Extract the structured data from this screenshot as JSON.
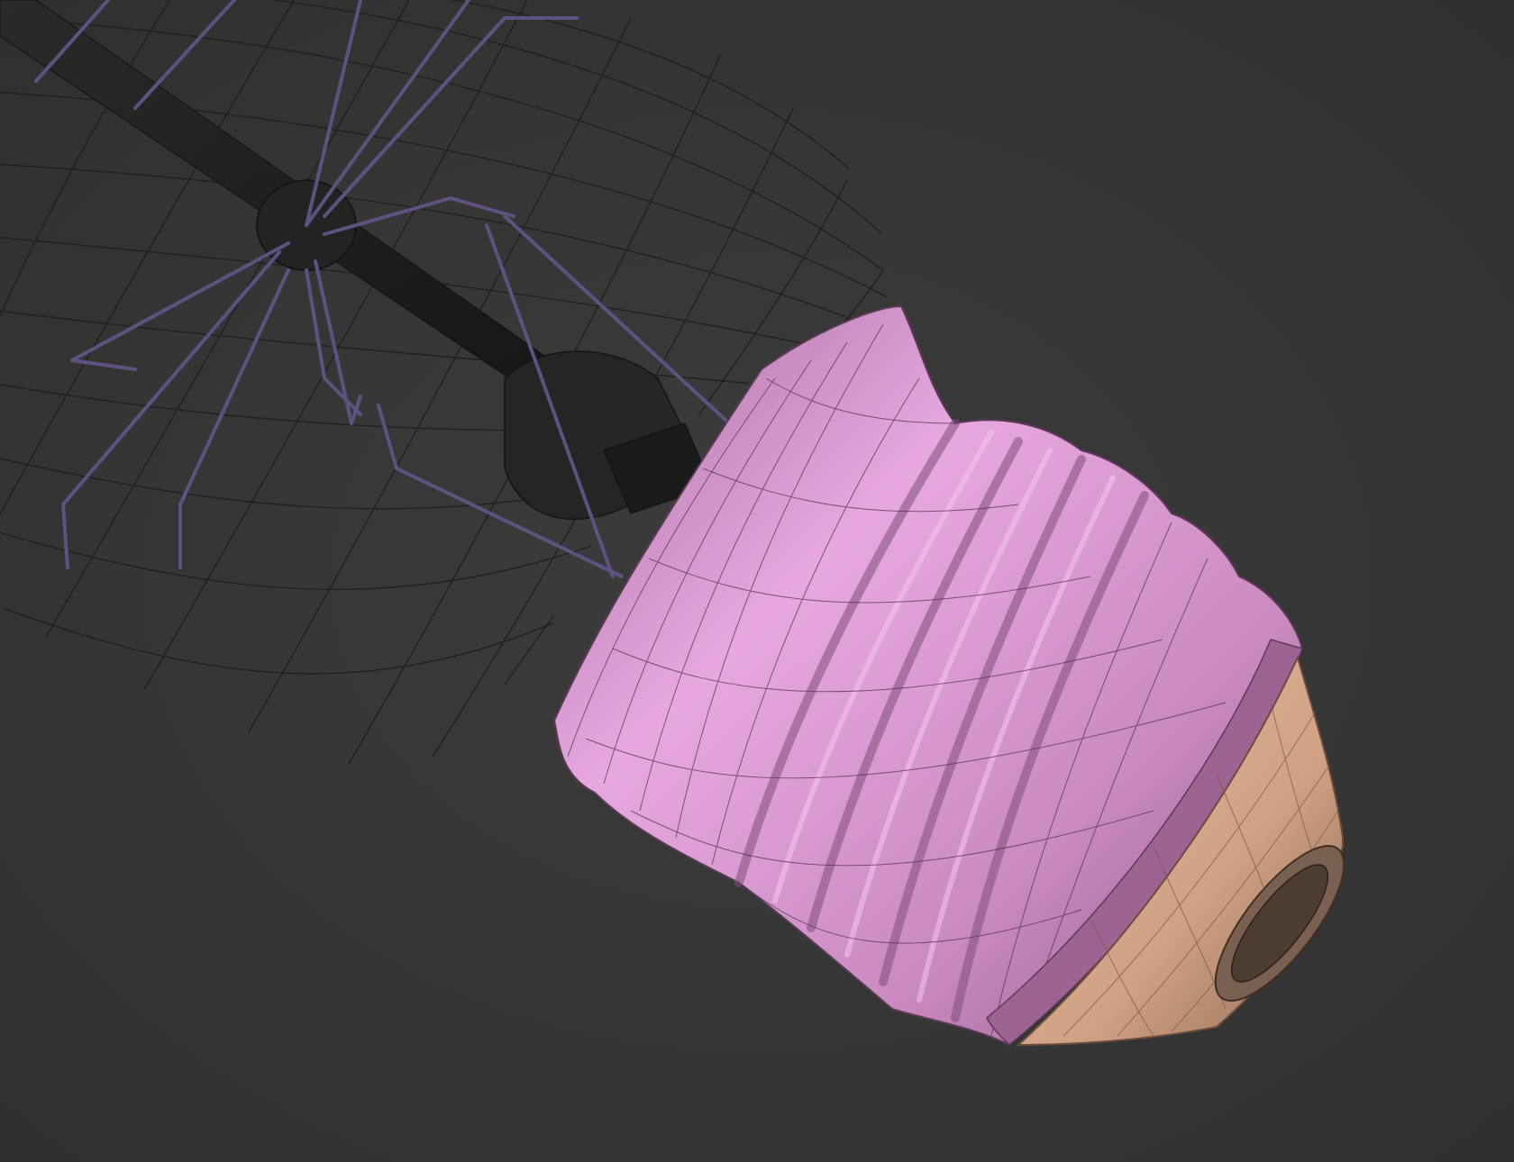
{
  "viewport": {
    "background": "#373737",
    "shading_mode": "wireframe-on-shaded"
  },
  "model": {
    "object": "light-bulb",
    "parts": [
      {
        "name": "glass-envelope",
        "display": "wireframe",
        "color": "#1c1c1c"
      },
      {
        "name": "filament-wires",
        "display": "wireframe",
        "color": "#5a4f78"
      },
      {
        "name": "stem",
        "display": "wireframe",
        "color": "#202020"
      },
      {
        "name": "screw-base",
        "display": "shaded",
        "color": "#d89ad0"
      },
      {
        "name": "contact-tip",
        "display": "shaded",
        "color": "#d6a98a"
      }
    ]
  }
}
